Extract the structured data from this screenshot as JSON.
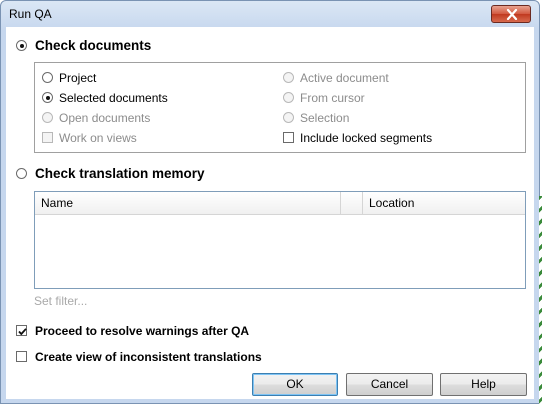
{
  "window": {
    "title": "Run QA"
  },
  "check_documents": {
    "label": "Check documents",
    "selected": true,
    "options": {
      "project": "Project",
      "selected_documents": "Selected documents",
      "open_documents": "Open documents",
      "work_on_views": "Work on views",
      "active_document": "Active document",
      "from_cursor": "From cursor",
      "selection": "Selection",
      "include_locked_segments": "Include locked segments"
    }
  },
  "check_tm": {
    "label": "Check translation memory",
    "selected": false,
    "columns": [
      "Name",
      "Location"
    ],
    "set_filter": "Set filter..."
  },
  "options": {
    "proceed_resolve": {
      "label": "Proceed to resolve warnings after QA",
      "checked": true
    },
    "create_view": {
      "label": "Create view of inconsistent translations",
      "checked": false
    }
  },
  "buttons": {
    "ok": "OK",
    "cancel": "Cancel",
    "help": "Help"
  },
  "colors": {
    "close_button": "#c0391f",
    "title_bar": "#c6d7ee"
  }
}
